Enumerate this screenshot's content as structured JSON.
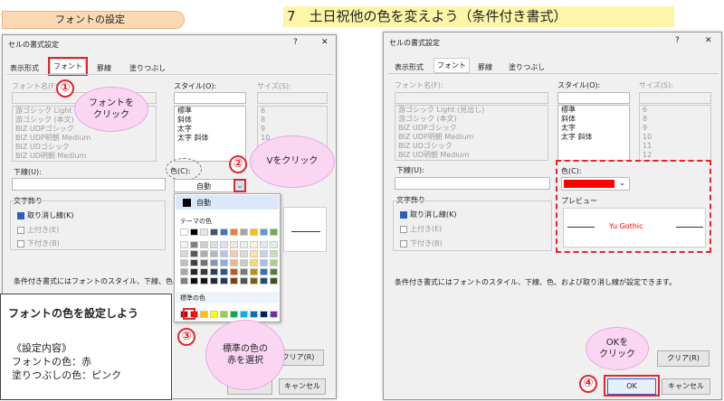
{
  "left_heading": "フォントの設定",
  "right_heading": "7　土日祝他の色を変えよう（条件付き書式）",
  "dialog": {
    "title": "セルの書式設定",
    "help": "?",
    "close": "✕",
    "tabs": [
      "表示形式",
      "フォント",
      "罫線",
      "塗りつぶし"
    ],
    "font_name_label": "フォント名(F):",
    "style_label": "スタイル(O):",
    "size_label": "サイズ(S):",
    "fonts": [
      "游ゴシック Light (見出し)",
      "游ゴシック (本文)",
      "BIZ UDPゴシック",
      "BIZ UDP明朝 Medium",
      "BIZ UDゴシック",
      "BIZ UD明朝 Medium"
    ],
    "fonts_left": [
      "游ゴシック Light (見",
      "游ゴシック (本文)",
      "BIZ UDPゴシック",
      "BIZ UDP明朝 Medium",
      "BIZ UDゴシック",
      "BIZ UD明朝 Medium"
    ],
    "styles": [
      "標準",
      "斜体",
      "太字",
      "太字 斜体"
    ],
    "sizes": [
      "6",
      "8",
      "9",
      "10",
      "11",
      "12"
    ],
    "underline_label": "下線(U):",
    "color_label": "色(C):",
    "color_value": "自動",
    "effects_label": "文字飾り",
    "strike": "取り消し線(K)",
    "superscript": "上付き(E)",
    "subscript": "下付き(B)",
    "preview_label": "プレビュー",
    "preview_text": "Yu Gothic",
    "note": "条件付き書式にはフォントのスタイル、下線、色、および取り消し線が設定できます。",
    "note_left": "条件付き書式にはフォントのスタイル、下線、色、および取",
    "clear": "クリア(R)",
    "ok": "OK",
    "cancel": "キャンセル"
  },
  "palette": {
    "auto": "自動",
    "theme_label": "テーマの色",
    "standard_label": "標準の色",
    "theme_top": [
      "#ffffff",
      "#000000",
      "#e7e6e6",
      "#44546a",
      "#4472c4",
      "#ed7d31",
      "#a5a5a5",
      "#ffc000",
      "#5b9bd5",
      "#70ad47"
    ],
    "theme_shades": [
      [
        "#f2f2f2",
        "#7f7f7f",
        "#d0cece",
        "#d6dce5",
        "#d9e2f3",
        "#fbe5d6",
        "#ededed",
        "#fff2cc",
        "#deebf7",
        "#e2f0d9"
      ],
      [
        "#d9d9d9",
        "#595959",
        "#aeabab",
        "#adb9ca",
        "#b4c7e7",
        "#f8cbad",
        "#dbdbdb",
        "#ffe699",
        "#bdd7ee",
        "#c5e0b4"
      ],
      [
        "#bfbfbf",
        "#404040",
        "#757171",
        "#8497b0",
        "#8faadc",
        "#f4b183",
        "#c9c9c9",
        "#ffd966",
        "#9dc3e6",
        "#a9d18e"
      ],
      [
        "#a6a6a6",
        "#262626",
        "#3b3838",
        "#333f50",
        "#2f5597",
        "#c55a11",
        "#7b7b7b",
        "#bf9000",
        "#2e75b6",
        "#548235"
      ],
      [
        "#7f7f7f",
        "#0d0d0d",
        "#171717",
        "#222a35",
        "#1f3864",
        "#843c0c",
        "#525252",
        "#7f6000",
        "#1f4e79",
        "#385723"
      ]
    ],
    "standard": [
      "#c00000",
      "#ff0000",
      "#ffc000",
      "#ffff00",
      "#92d050",
      "#00b050",
      "#00b0f0",
      "#0070c0",
      "#002060",
      "#7030a0"
    ]
  },
  "callouts": {
    "c1": "フォントを\nクリック",
    "c2": "Vをクリック",
    "c3": "標準の色の\n赤を選択",
    "c4": "OKを\nクリック",
    "n1": "①",
    "n2": "②",
    "n3": "③",
    "n4": "④"
  },
  "note_box": {
    "title": "フォントの色を設定しよう",
    "lines": [
      "《設定内容》",
      "フォントの色：赤",
      "塗りつぶしの色：ピンク"
    ]
  },
  "colors": {
    "accent_red": "#e3262b",
    "chosen_color": "#ff0000",
    "callout_pink": "#fbd6f3",
    "orange_heading": "#fcd9b5",
    "yellow_heading": "#fdf6a8"
  }
}
